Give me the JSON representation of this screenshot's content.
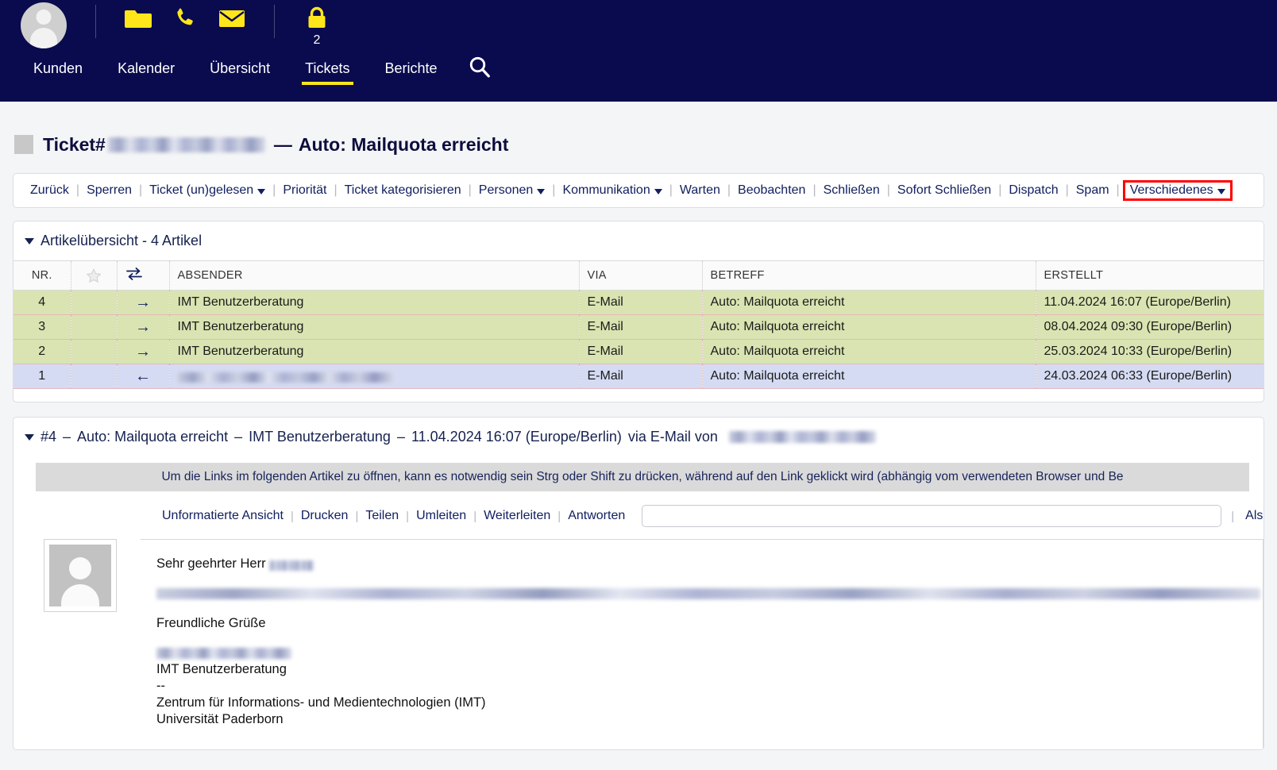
{
  "nav": {
    "avatar_name": "user-avatar",
    "icons": [
      {
        "name": "folder-icon",
        "label": "Folder"
      },
      {
        "name": "phone-icon",
        "label": "Phone"
      },
      {
        "name": "envelope-icon",
        "label": "E-Mail"
      }
    ],
    "lock": {
      "name": "lock-icon",
      "label": "Gesperrte Tickets",
      "count": "2"
    },
    "links": [
      {
        "label": "Kunden",
        "active": false
      },
      {
        "label": "Kalender",
        "active": false
      },
      {
        "label": "Übersicht",
        "active": false
      },
      {
        "label": "Tickets",
        "active": true
      },
      {
        "label": "Berichte",
        "active": false
      }
    ],
    "search_label": "Suche",
    "bg_color": "#0a0a4e",
    "accent_color": "#ffe61a"
  },
  "header": {
    "ticket_prefix": "Ticket#",
    "ticket_number_redacted": true,
    "separator": "—",
    "subject": "Auto: Mailquota erreicht"
  },
  "toolbar": {
    "items": [
      {
        "label": "Zurück",
        "dropdown": false
      },
      {
        "label": "Sperren",
        "dropdown": false
      },
      {
        "label": "Ticket (un)gelesen",
        "dropdown": true
      },
      {
        "label": "Priorität",
        "dropdown": false
      },
      {
        "label": "Ticket kategorisieren",
        "dropdown": false
      },
      {
        "label": "Personen",
        "dropdown": true
      },
      {
        "label": "Kommunikation",
        "dropdown": true
      },
      {
        "label": "Warten",
        "dropdown": false
      },
      {
        "label": "Beobachten",
        "dropdown": false
      },
      {
        "label": "Schließen",
        "dropdown": false
      },
      {
        "label": "Sofort Schließen",
        "dropdown": false
      },
      {
        "label": "Dispatch",
        "dropdown": false
      },
      {
        "label": "Spam",
        "dropdown": false
      }
    ],
    "highlighted": {
      "label": "Verschiedenes",
      "dropdown": true,
      "outline_color": "#ff0000"
    }
  },
  "overview": {
    "title": "Artikelübersicht - 4 Artikel",
    "columns": [
      "NR.",
      "star-icon",
      "swap-icon",
      "ABSENDER",
      "VIA",
      "BETREFF",
      "ERSTELLT"
    ],
    "column_labels": {
      "nr": "NR.",
      "absender": "ABSENDER",
      "via": "VIA",
      "betreff": "BETREFF",
      "erstellt": "ERSTELLT"
    },
    "rows": [
      {
        "nr": "4",
        "direction": "→",
        "sender": "IMT Benutzerberatung",
        "sender_redacted": false,
        "via": "E-Mail",
        "subject": "Auto: Mailquota erreicht",
        "created": "11.04.2024 16:07 (Europe/Berlin)",
        "highlight": "green"
      },
      {
        "nr": "3",
        "direction": "→",
        "sender": "IMT Benutzerberatung",
        "sender_redacted": false,
        "via": "E-Mail",
        "subject": "Auto: Mailquota erreicht",
        "created": "08.04.2024 09:30 (Europe/Berlin)",
        "highlight": "green"
      },
      {
        "nr": "2",
        "direction": "→",
        "sender": "IMT Benutzerberatung",
        "sender_redacted": false,
        "via": "E-Mail",
        "subject": "Auto: Mailquota erreicht",
        "created": "25.03.2024 10:33 (Europe/Berlin)",
        "highlight": "green"
      },
      {
        "nr": "1",
        "direction": "←",
        "sender": "",
        "sender_redacted": true,
        "via": "E-Mail",
        "subject": "Auto: Mailquota erreicht",
        "created": "24.03.2024 06:33 (Europe/Berlin)",
        "highlight": "blue"
      }
    ],
    "row_colors": {
      "green": "#d9e4b2",
      "blue": "#d5dbf2"
    }
  },
  "article": {
    "header_number": "#4",
    "header_dash": "–",
    "header_subject": "Auto: Mailquota erreicht",
    "header_sender": "IMT Benutzerberatung",
    "header_date": "11.04.2024 16:07 (Europe/Berlin)",
    "header_via": "via E-Mail von",
    "header_from_redacted": true,
    "notice": "Um die Links im folgenden Artikel zu öffnen, kann es notwendig sein Strg oder Shift zu drücken, während auf den Link geklickt wird (abhängig vom verwendeten Browser und Be",
    "actions": [
      {
        "label": "Unformatierte Ansicht"
      },
      {
        "label": "Drucken"
      },
      {
        "label": "Teilen"
      },
      {
        "label": "Umleiten"
      },
      {
        "label": "Weiterleiten"
      },
      {
        "label": "Antworten"
      }
    ],
    "reply_input_value": "",
    "reply_input_placeholder": "",
    "action_right_label": "Als",
    "body": {
      "salutation_prefix": "Sehr geehrter Herr",
      "salutation_name_redacted": true,
      "paragraph_redacted": true,
      "closing": "Freundliche Grüße",
      "signature_name_redacted": true,
      "signature_lines": [
        "IMT Benutzerberatung",
        "--",
        "Zentrum für Informations- und Medientechnologien (IMT)",
        "Universität Paderborn"
      ]
    }
  }
}
